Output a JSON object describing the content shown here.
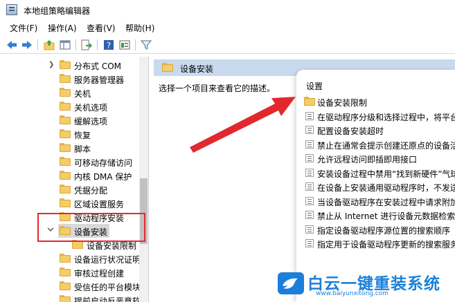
{
  "window": {
    "title": "本地组策略编辑器"
  },
  "menu": [
    "文件(F)",
    "操作(A)",
    "查看(V)",
    "帮助(H)"
  ],
  "toolbar": {
    "icons": [
      "back-icon",
      "forward-icon",
      "up-folder-icon",
      "show-hide-tree-icon",
      "export-list-icon",
      "help-icon",
      "properties-icon",
      "filter-icon"
    ]
  },
  "tree": {
    "items": [
      {
        "label": "分布式 COM",
        "expandable": true
      },
      {
        "label": "服务器管理器"
      },
      {
        "label": "关机"
      },
      {
        "label": "关机选项"
      },
      {
        "label": "缓解选项"
      },
      {
        "label": "恢复"
      },
      {
        "label": "脚本"
      },
      {
        "label": "可移动存储访问"
      },
      {
        "label": "内核 DMA 保护"
      },
      {
        "label": "凭据分配"
      },
      {
        "label": "区域设置服务"
      },
      {
        "label": "驱动程序安装"
      },
      {
        "label": "设备安装",
        "expanded": true,
        "selected": true
      },
      {
        "label": "设备安装限制",
        "child": true
      },
      {
        "label": "设备运行状况证明"
      },
      {
        "label": "审核过程创建"
      },
      {
        "label": "受信任的平台模块"
      },
      {
        "label": "提前启动反恶意软"
      }
    ]
  },
  "right": {
    "header": "设备安装",
    "description": "选择一个项目来查看它的描述。",
    "list_title": "设置",
    "items": [
      {
        "label": "设备安装限制",
        "type": "folder"
      },
      {
        "label": "在驱动程序分级和选择过程中，将平台",
        "type": "policy"
      },
      {
        "label": "配置设备安装超时",
        "type": "policy"
      },
      {
        "label": "禁止在通常会提示创建还原点的设备活",
        "type": "policy"
      },
      {
        "label": "允许远程访问即插即用接口",
        "type": "policy"
      },
      {
        "label": "安装设备过程中禁用“找到新硬件”气球",
        "type": "policy"
      },
      {
        "label": "在设备上安装通用驱动程序时，不发送",
        "type": "policy"
      },
      {
        "label": "当设备驱动程序在安装过程中请求附加",
        "type": "policy"
      },
      {
        "label": "禁止从 Internet 进行设备元数据检索",
        "type": "policy"
      },
      {
        "label": "指定设备驱动程序源位置的搜索顺序",
        "type": "policy"
      },
      {
        "label": "指定用于设备驱动程序更新的搜索服务",
        "type": "policy"
      }
    ]
  },
  "watermark": {
    "brand": "白云一键重装系统",
    "url": "www.baiyunxitong.com"
  },
  "colors": {
    "highlight": "#e2282f",
    "header": "#c9d9ee",
    "folder": "#f5cd67",
    "brand": "#1b7fd9"
  }
}
